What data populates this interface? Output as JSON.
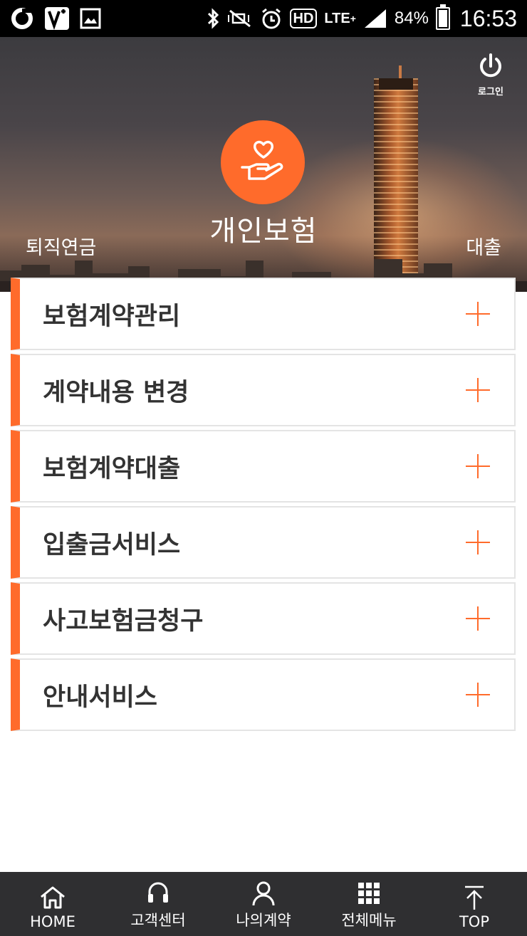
{
  "status_bar": {
    "battery": "84%",
    "time": "16:53",
    "network": "LTE",
    "hd": "HD"
  },
  "header": {
    "login_label": "로그인",
    "main_title": "개인보험",
    "left_tab": "퇴직연금",
    "right_tab": "대출"
  },
  "menu": {
    "items": [
      {
        "label": "보험계약관리"
      },
      {
        "label": "계약내용 변경"
      },
      {
        "label": "보험계약대출"
      },
      {
        "label": "입출금서비스"
      },
      {
        "label": "사고보험금청구"
      },
      {
        "label": "안내서비스"
      }
    ]
  },
  "bottom_nav": {
    "items": [
      {
        "label": "HOME"
      },
      {
        "label": "고객센터"
      },
      {
        "label": "나의계약"
      },
      {
        "label": "전체메뉴"
      },
      {
        "label": "TOP"
      }
    ]
  },
  "colors": {
    "accent": "#ff6b2b",
    "nav_bg": "#2f2f31",
    "text": "#333333"
  }
}
